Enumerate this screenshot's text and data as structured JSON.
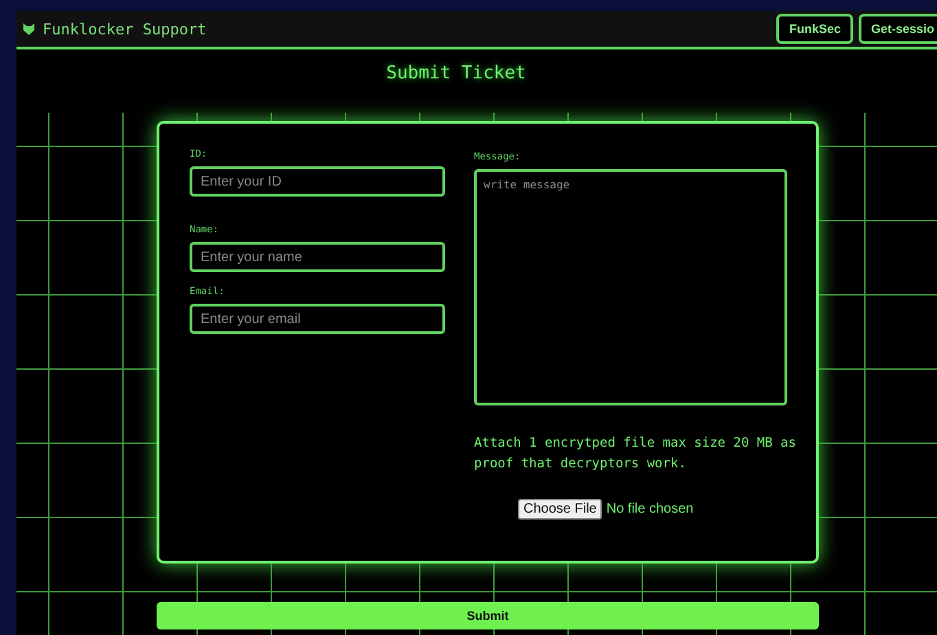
{
  "header": {
    "title": "Funklocker Support",
    "buttons": [
      "FunkSec",
      "Get-sessio"
    ]
  },
  "page_title": "Submit Ticket",
  "form": {
    "fields": [
      {
        "label": "ID:",
        "placeholder": "Enter your ID"
      },
      {
        "label": "Name:",
        "placeholder": "Enter your name"
      },
      {
        "label": "Email:",
        "placeholder": "Enter your email"
      }
    ],
    "message": {
      "label": "Message:",
      "placeholder": "write message"
    },
    "attach_note": "Attach 1 encrytped file max size 20 MB as proof that decryptors work.",
    "file_button": "Choose File",
    "file_status": "No file chosen"
  },
  "submit": "Submit"
}
